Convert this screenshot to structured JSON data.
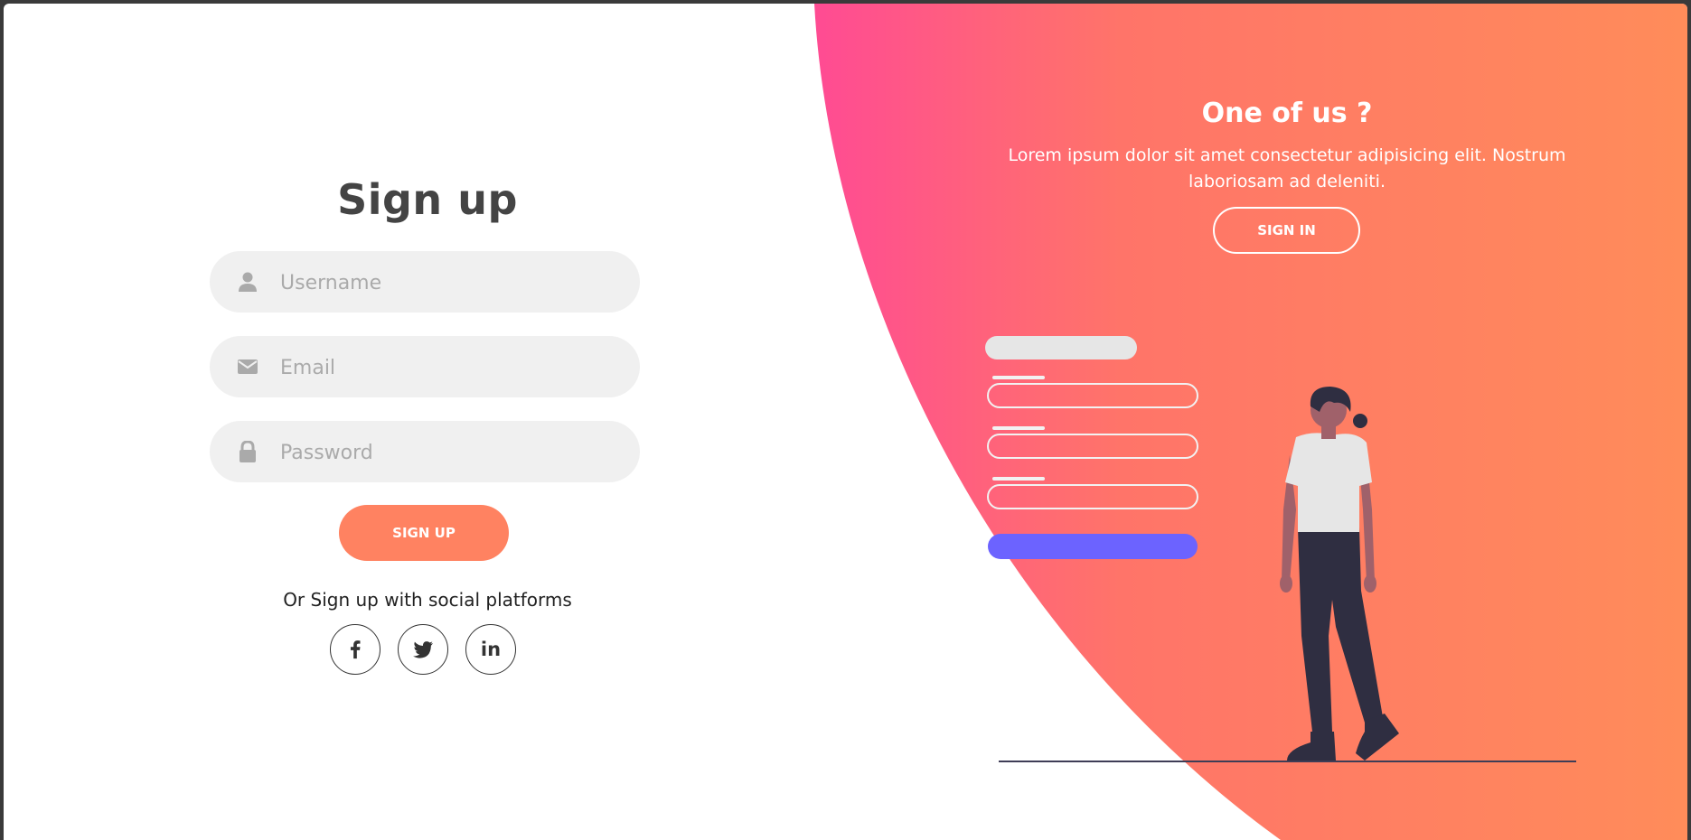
{
  "signup": {
    "title": "Sign up",
    "username": {
      "placeholder": "Username",
      "icon": "user-icon"
    },
    "email": {
      "placeholder": "Email",
      "icon": "envelope-icon"
    },
    "password": {
      "placeholder": "Password",
      "icon": "lock-icon"
    },
    "submit_label": "SIGN UP",
    "social_text": "Or Sign up with social platforms",
    "socials": [
      {
        "label": "f",
        "icon": "facebook-icon"
      },
      {
        "label": "twitter",
        "icon": "twitter-icon"
      },
      {
        "label": "in",
        "icon": "linkedin-icon"
      }
    ]
  },
  "panel": {
    "title": "One of us ?",
    "text": "Lorem ipsum dolor sit amet consectetur adipisicing elit. Nostrum laboriosam ad deleniti.",
    "button_label": "SIGN IN"
  },
  "colors": {
    "accent": "#ff8261",
    "gradient_start": "#ff4b93",
    "gradient_end": "#ff8c5a",
    "form_button": "#6c63ff",
    "text_dark": "#444444"
  }
}
